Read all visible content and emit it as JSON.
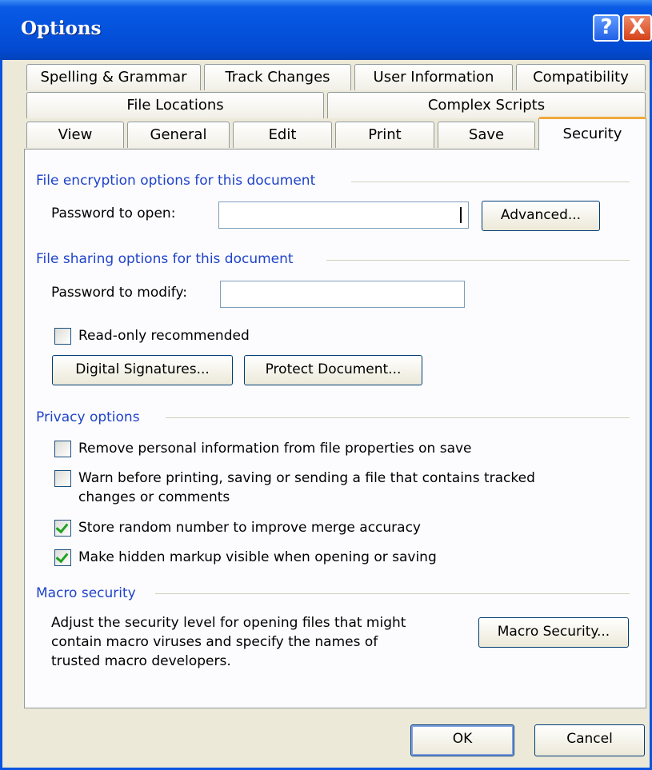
{
  "window": {
    "title": "Options",
    "help_glyph": "?",
    "close_glyph": "X"
  },
  "tabs": {
    "row1": [
      "Spelling & Grammar",
      "Track Changes",
      "User Information",
      "Compatibility"
    ],
    "row2": [
      "File Locations",
      "Complex Scripts"
    ],
    "row3": [
      "View",
      "General",
      "Edit",
      "Print",
      "Save",
      "Security"
    ],
    "active": "Security"
  },
  "encryption": {
    "heading": "File encryption options for this document",
    "password_open_label": "Password to open:",
    "password_open_value": "",
    "advanced_button": "Advanced..."
  },
  "sharing": {
    "heading": "File sharing options for this document",
    "password_modify_label": "Password to modify:",
    "password_modify_value": "",
    "readonly_label": "Read-only recommended",
    "readonly_checked": false,
    "digital_signatures_button": "Digital Signatures...",
    "protect_document_button": "Protect Document..."
  },
  "privacy": {
    "heading": "Privacy options",
    "options": [
      {
        "label": "Remove personal information from file properties on save",
        "checked": false
      },
      {
        "label": "Warn before printing, saving or sending a file that contains tracked",
        "label2": "changes or comments",
        "checked": false
      },
      {
        "label": "Store random number to improve merge accuracy",
        "checked": true
      },
      {
        "label": "Make hidden markup visible when opening or saving",
        "checked": true
      }
    ]
  },
  "macro": {
    "heading": "Macro security",
    "description_lines": [
      "Adjust the security level for opening files that might",
      "contain macro viruses and specify the names of",
      "trusted macro developers."
    ],
    "macro_security_button": "Macro Security..."
  },
  "footer": {
    "ok_button": "OK",
    "cancel_button": "Cancel"
  },
  "colors": {
    "title_bar": "#0452dc",
    "section_heading": "#1f43c8",
    "active_tab_accent": "#f0a83a",
    "dialog_face": "#ece9d8"
  }
}
